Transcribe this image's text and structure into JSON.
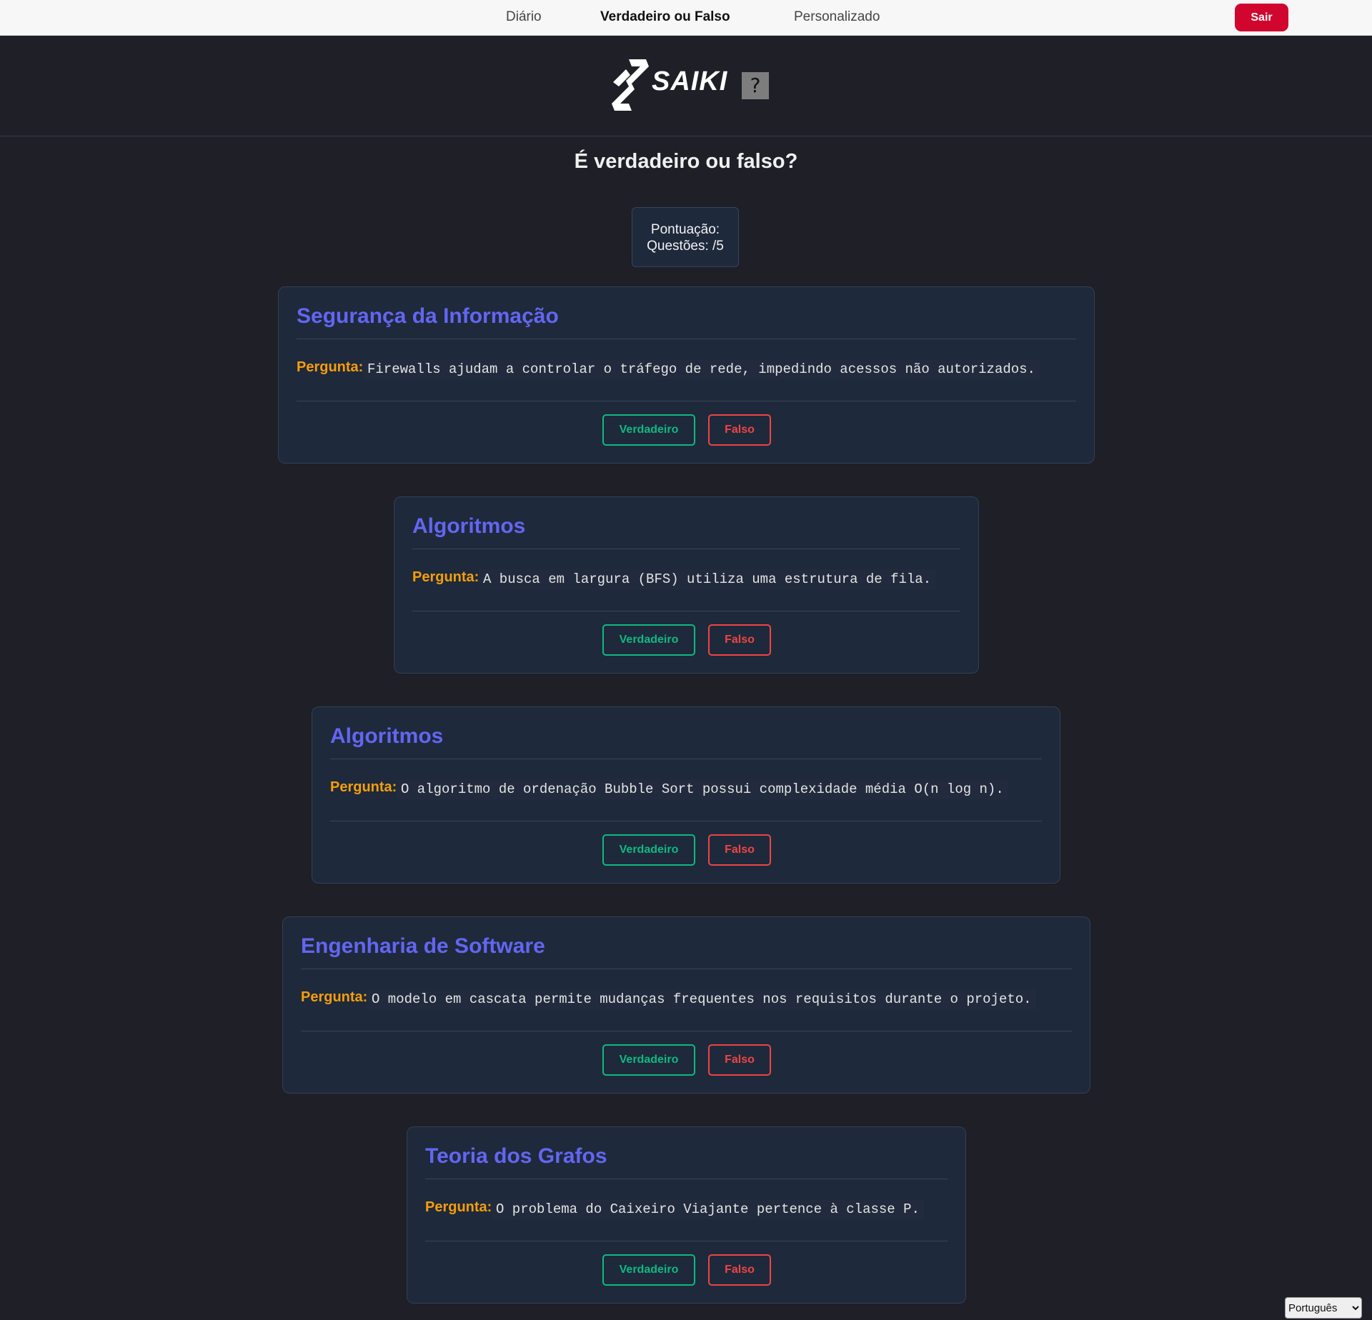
{
  "nav": {
    "links": [
      "Diário",
      "Verdadeiro ou Falso",
      "Personalizado"
    ],
    "active": "Verdadeiro ou Falso",
    "logout_label": "Sair"
  },
  "header": {
    "logo_text": "SAIKI",
    "help_label": "?"
  },
  "page_title": "É verdadeiro ou falso?",
  "score": {
    "score_label": "Pontuação:",
    "questions_label": "Questões: /5"
  },
  "cards": [
    {
      "category": "Segurança da Informação",
      "question_label": "Pergunta:",
      "question": "Firewalls ajudam a controlar o tráfego de rede, impedindo acessos não autorizados.",
      "true_label": "Verdadeiro",
      "false_label": "Falso"
    },
    {
      "category": "Algoritmos",
      "question_label": "Pergunta:",
      "question": "A busca em largura (BFS) utiliza uma estrutura de fila.",
      "true_label": "Verdadeiro",
      "false_label": "Falso"
    },
    {
      "category": "Algoritmos",
      "question_label": "Pergunta:",
      "question": "O algoritmo de ordenação Bubble Sort possui complexidade média O(n log n).",
      "true_label": "Verdadeiro",
      "false_label": "Falso"
    },
    {
      "category": "Engenharia de Software",
      "question_label": "Pergunta:",
      "question": "O modelo em cascata permite mudanças frequentes nos requisitos durante o projeto.",
      "true_label": "Verdadeiro",
      "false_label": "Falso"
    },
    {
      "category": "Teoria dos Grafos",
      "question_label": "Pergunta:",
      "question": "O problema do Caixeiro Viajante pertence à classe P.",
      "true_label": "Verdadeiro",
      "false_label": "Falso"
    }
  ],
  "language": {
    "selected": "Português"
  },
  "colors": {
    "background": "#1e1f27",
    "card": "#1e293b",
    "category_title": "#6366f1",
    "question_label": "#f59e0b",
    "true_button": "#10b981",
    "false_button": "#ef4444",
    "logout_button": "#d1062f"
  }
}
